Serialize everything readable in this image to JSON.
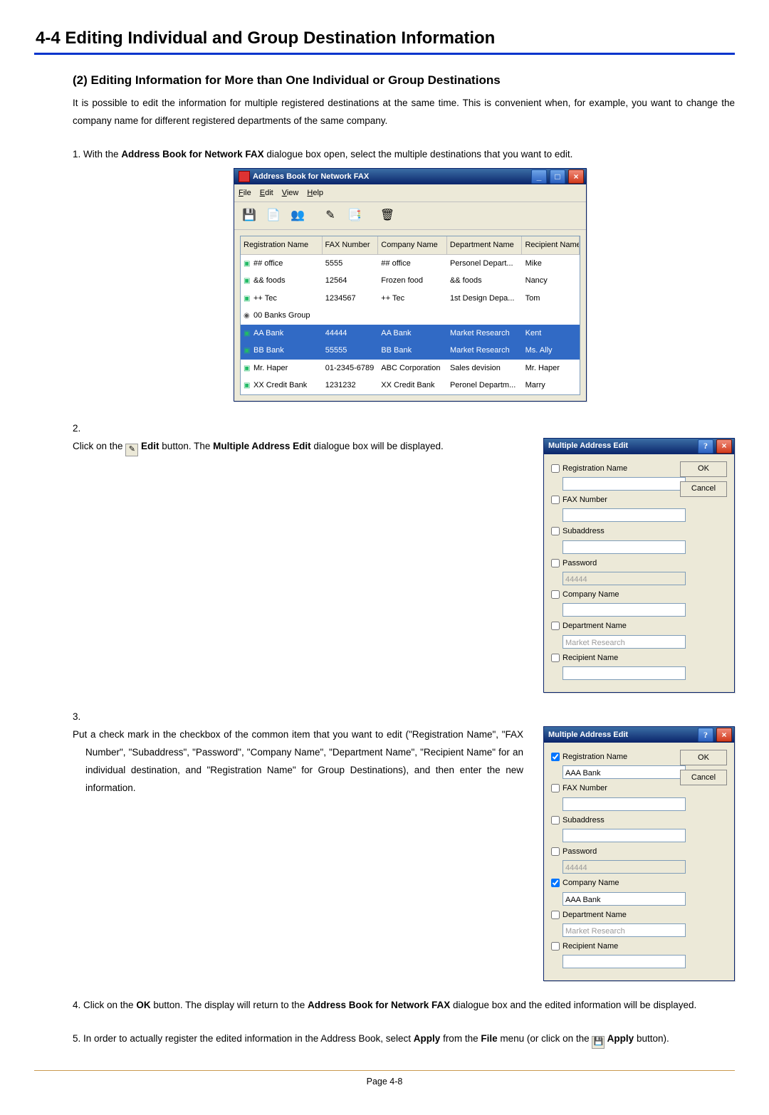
{
  "page": {
    "section_title": "4-4  Editing Individual and Group Destination Information",
    "sub_title": "(2) Editing Information for More than One Individual or Group Destinations",
    "intro": "It is possible to edit the information for multiple registered destinations at the same time. This is convenient when, for example, you want to change the company name for different registered departments of the same company.",
    "page_number": "Page 4-8"
  },
  "steps": {
    "s1_a": "With the ",
    "s1_b": "Address Book for Network FAX",
    "s1_c": " dialogue box open, select the multiple destinations that you want to edit.",
    "s2_a": "Click on the ",
    "s2_b": " Edit",
    "s2_c": " button. The ",
    "s2_d": "Multiple Address Edit",
    "s2_e": " dialogue box will be displayed.",
    "s3": "Put a check mark in the checkbox of the common item that you want to edit (\"Registration Name\", \"FAX Number\", \"Subaddress\", \"Password\", \"Company Name\", \"Department Name\", \"Recipient Name\" for an individual destination, and \"Registration Name\" for Group Destinations), and then enter the new information.",
    "s4_a": "Click on the ",
    "s4_b": "OK",
    "s4_c": " button. The display will return to the ",
    "s4_d": "Address Book for Network FAX",
    "s4_e": " dialogue box and the edited information will be displayed.",
    "s5_a": "In order to actually register the edited information in the Address Book, select ",
    "s5_b": "Apply",
    "s5_c": " from the ",
    "s5_d": "File",
    "s5_e": " menu (or click on the ",
    "s5_f": " Apply",
    "s5_g": " button)."
  },
  "addrbook": {
    "title": "Address Book for Network FAX",
    "menu": {
      "file": "File",
      "edit": "Edit",
      "view": "View",
      "help": "Help"
    },
    "columns": {
      "c1": "Registration Name",
      "c2": "FAX Number",
      "c3": "Company Name",
      "c4": "Department Name",
      "c5": "Recipient Name"
    },
    "rows": [
      {
        "sel": false,
        "group": false,
        "r1": "## office",
        "r2": "5555",
        "r3": "## office",
        "r4": "Personel Depart...",
        "r5": "Mike"
      },
      {
        "sel": false,
        "group": false,
        "r1": "&& foods",
        "r2": "12564",
        "r3": "Frozen food",
        "r4": "&& foods",
        "r5": "Nancy"
      },
      {
        "sel": false,
        "group": false,
        "r1": "++ Tec",
        "r2": "1234567",
        "r3": "++ Tec",
        "r4": "1st Design Depa...",
        "r5": "Tom"
      },
      {
        "sel": false,
        "group": true,
        "r1": "00 Banks Group",
        "r2": "",
        "r3": "",
        "r4": "",
        "r5": ""
      },
      {
        "sel": true,
        "group": false,
        "r1": "AA Bank",
        "r2": "44444",
        "r3": "AA Bank",
        "r4": "Market Research",
        "r5": "Kent"
      },
      {
        "sel": true,
        "group": false,
        "r1": "BB Bank",
        "r2": "55555",
        "r3": "BB Bank",
        "r4": "Market Research",
        "r5": "Ms. Ally"
      },
      {
        "sel": false,
        "group": false,
        "r1": "Mr. Haper",
        "r2": "01-2345-6789",
        "r3": "ABC Corporation",
        "r4": "Sales devision",
        "r5": "Mr. Haper"
      },
      {
        "sel": false,
        "group": false,
        "r1": "XX Credit Bank",
        "r2": "1231232",
        "r3": "XX Credit Bank",
        "r4": "Peronel Departm...",
        "r5": "Marry"
      }
    ]
  },
  "maedit": {
    "title": "Multiple Address Edit",
    "ok": "OK",
    "cancel": "Cancel",
    "labels": {
      "reg": "Registration Name",
      "fax": "FAX Number",
      "sub": "Subaddress",
      "pwd": "Password",
      "comp": "Company Name",
      "dept": "Department Name",
      "recip": "Recipient Name"
    },
    "initial": {
      "pwd_placeholder": "44444",
      "dept_placeholder": "Market Research"
    },
    "edited": {
      "reg_value": "AAA Bank",
      "pwd_placeholder": "44444",
      "comp_value": "AAA Bank",
      "dept_placeholder": "Market Research"
    }
  }
}
